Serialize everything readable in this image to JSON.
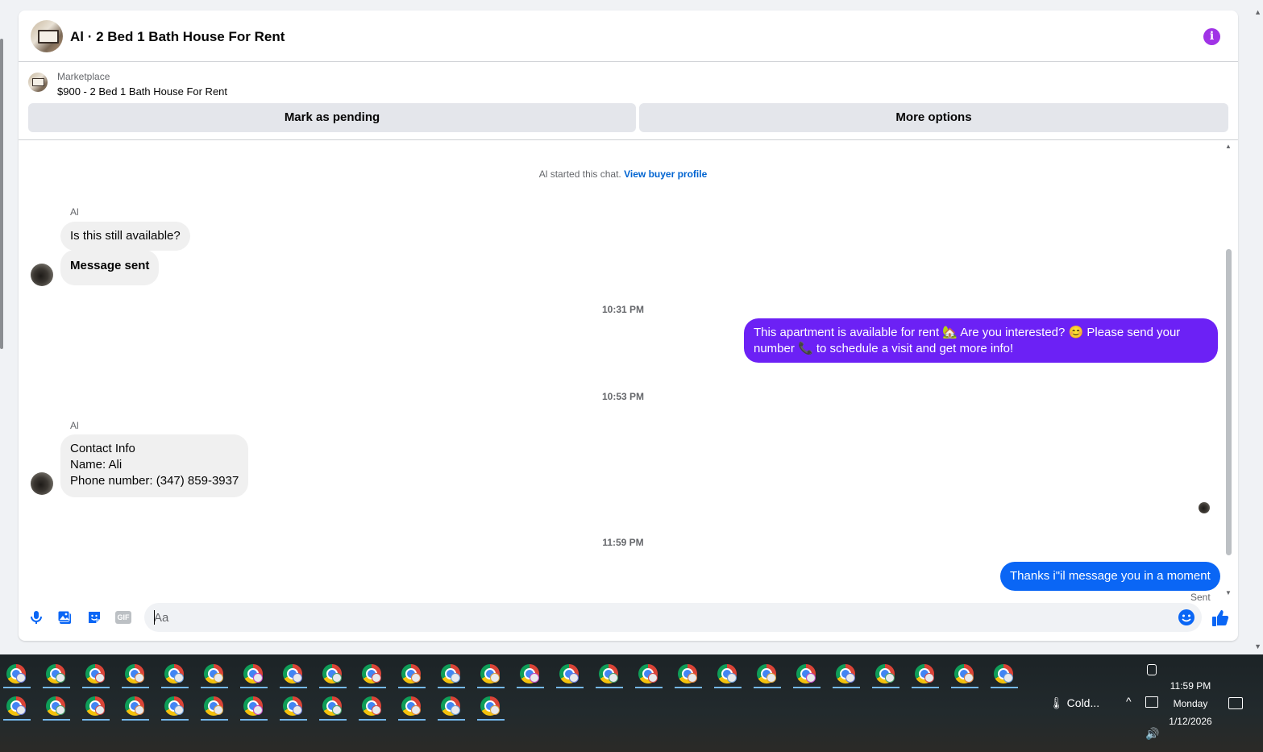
{
  "header": {
    "title": "Al · 2 Bed 1 Bath House For Rent",
    "info_icon": "info-icon"
  },
  "listing": {
    "label": "Marketplace",
    "price_title": "$900 - 2 Bed 1 Bath House For Rent",
    "mark_pending_label": "Mark as pending",
    "more_options_label": "More options"
  },
  "chat": {
    "system_text": "Al started this chat.",
    "system_link": "View buyer profile",
    "messages": [
      {
        "sender": "Al",
        "text": "Is this still available?"
      },
      {
        "text": "Message sent"
      },
      {
        "timestamp": "10:31 PM"
      },
      {
        "text_line1": "This apartment is available for rent 🏡 Are you interested? 😊 Please send your",
        "text_line2": "number 📞 to schedule a visit and get more info!"
      },
      {
        "timestamp": "10:53 PM"
      },
      {
        "sender": "Al",
        "line1": "Contact Info",
        "line2": "Name: Ali",
        "line3": "Phone number: (347) 859-3937"
      },
      {
        "timestamp": "11:59 PM"
      },
      {
        "text": "Thanks i\"il message you in a moment",
        "status": "Sent"
      }
    ]
  },
  "composer": {
    "placeholder": "Aa",
    "icons": [
      "microphone-icon",
      "photo-icon",
      "sticker-icon",
      "gif-icon",
      "emoji-icon",
      "thumbs-up-icon"
    ],
    "gif_label": "GIF"
  },
  "colors": {
    "purple_bubble": "#6c21f5",
    "blue_bubble": "#0a66f5",
    "accent": "#0064d1",
    "info": "#a033e6"
  },
  "taskbar": {
    "row1_count": 26,
    "row2_count": 13,
    "weather_text": "Cold...",
    "time": "11:59 PM",
    "day": "Monday",
    "date": "1/12/2026"
  }
}
